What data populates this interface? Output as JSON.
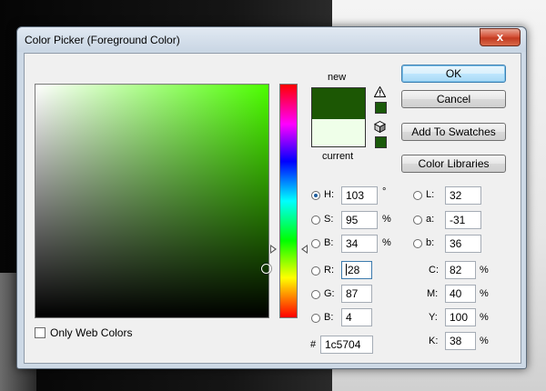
{
  "window": {
    "title": "Color Picker (Foreground Color)",
    "close_label": "x"
  },
  "swatches": {
    "new_label": "new",
    "current_label": "current",
    "new_color": "#1c5704",
    "current_color": "#efffe9"
  },
  "buttons": {
    "ok": "OK",
    "cancel": "Cancel",
    "add_to_swatches": "Add To Swatches",
    "color_libraries": "Color Libraries"
  },
  "hsb": {
    "h": {
      "label": "H:",
      "value": "103",
      "unit": "°"
    },
    "s": {
      "label": "S:",
      "value": "95",
      "unit": "%"
    },
    "b": {
      "label": "B:",
      "value": "34",
      "unit": "%"
    }
  },
  "rgb": {
    "r": {
      "label": "R:",
      "value": "28"
    },
    "g": {
      "label": "G:",
      "value": "87"
    },
    "b": {
      "label": "B:",
      "value": "4"
    }
  },
  "hex": {
    "label": "#",
    "value": "1c5704"
  },
  "lab": {
    "l": {
      "label": "L:",
      "value": "32"
    },
    "a": {
      "label": "a:",
      "value": "-31"
    },
    "b": {
      "label": "b:",
      "value": "36"
    }
  },
  "cmyk": {
    "c": {
      "label": "C:",
      "value": "82",
      "unit": "%"
    },
    "m": {
      "label": "M:",
      "value": "40",
      "unit": "%"
    },
    "y": {
      "label": "Y:",
      "value": "100",
      "unit": "%"
    },
    "k": {
      "label": "K:",
      "value": "38",
      "unit": "%"
    }
  },
  "only_web_colors": {
    "label": "Only Web Colors",
    "checked": false
  },
  "selected_mode": "H",
  "colors": {
    "accent": "#3c7fb1",
    "field_hue": "#4cff00"
  },
  "icons": {
    "gamut_warning": "warning-triangle-icon",
    "web_safe": "cube-icon"
  }
}
